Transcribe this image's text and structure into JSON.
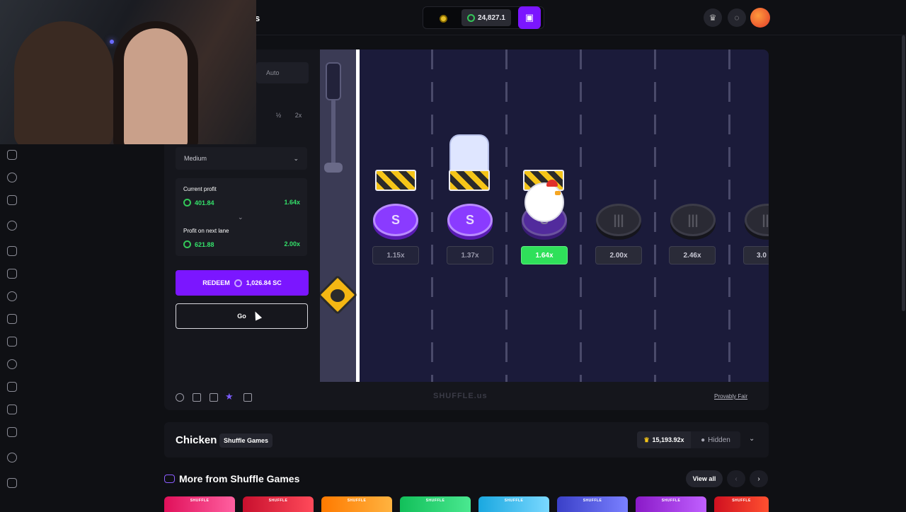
{
  "header": {
    "brand_fragment": "s",
    "balance": "24,827.1",
    "wallet_icon": "wallet-icon",
    "icons": [
      "crown-icon",
      "chat-icon"
    ]
  },
  "controls": {
    "auto_tab": "Auto",
    "half": "½",
    "double": "2x",
    "difficulty": "Medium",
    "current_profit_label": "Current profit",
    "current_profit_value": "401.84",
    "current_profit_mult": "1.64x",
    "next_profit_label": "Profit on next lane",
    "next_profit_value": "621.88",
    "next_profit_mult": "2.00x",
    "redeem_label": "REDEEM",
    "redeem_amount": "1,026.84 SC",
    "go_label": "Go"
  },
  "board": {
    "multipliers": [
      "1.15x",
      "1.37x",
      "1.64x",
      "2.00x",
      "2.46x",
      "3.0"
    ]
  },
  "footer": {
    "watermark": "SHUFFLE.us",
    "provably_fair": "Provably Fair"
  },
  "info": {
    "title": "Chicken",
    "provider": "Shuffle Games",
    "record": "15,193.92x",
    "hidden": "Hidden"
  },
  "more": {
    "title": "More from Shuffle Games",
    "view_all": "View all",
    "prev": "‹",
    "next": "›",
    "thumbs": [
      "SHUFFLE",
      "SHUFFLE",
      "SHUFFLE",
      "SHUFFLE",
      "SHUFFLE",
      "SHUFFLE",
      "SHUFFLE",
      "SHUFFLE"
    ]
  },
  "colors": {
    "accent": "#7b16ff",
    "profit_green": "#34e06a",
    "active_lane": "#2fe05a"
  }
}
